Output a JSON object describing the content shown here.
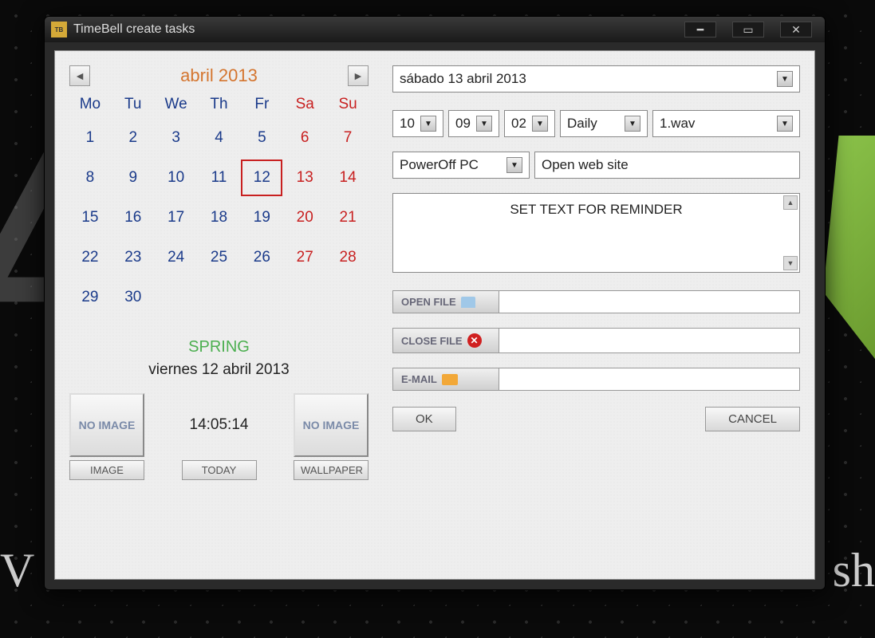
{
  "window": {
    "title": "TimeBell create tasks"
  },
  "calendar": {
    "month_label": "abril 2013",
    "dow": [
      "Mo",
      "Tu",
      "We",
      "Th",
      "Fr",
      "Sa",
      "Su"
    ],
    "days": [
      1,
      2,
      3,
      4,
      5,
      6,
      7,
      8,
      9,
      10,
      11,
      12,
      13,
      14,
      15,
      16,
      17,
      18,
      19,
      20,
      21,
      22,
      23,
      24,
      25,
      26,
      27,
      28,
      29,
      30
    ],
    "today": 12,
    "season": "SPRING",
    "date_str": "viernes 12 abril 2013",
    "time": "14:05:14"
  },
  "buttons": {
    "no_image": "NO IMAGE",
    "image": "IMAGE",
    "today": "TODAY",
    "wallpaper": "WALLPAPER",
    "open_file": "OPEN FILE",
    "close_file": "CLOSE FILE",
    "email": "E-MAIL",
    "ok": "OK",
    "cancel": "CANCEL"
  },
  "form": {
    "date_selected": "sábado  13     abril     2013",
    "hour": "10",
    "minute": "09",
    "second": "02",
    "repeat": "Daily",
    "sound": "1.wav",
    "action": "PowerOff PC",
    "url": "Open web site",
    "reminder": "SET TEXT FOR REMINDER"
  }
}
